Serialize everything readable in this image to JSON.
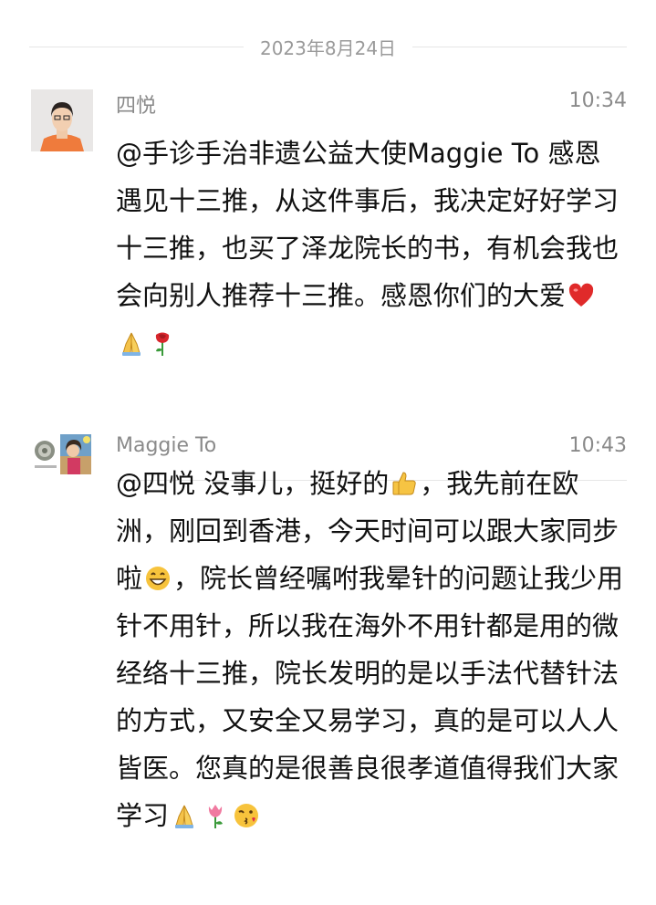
{
  "chat": {
    "date": "2023年8月24日",
    "messages": [
      {
        "sender": "四悦",
        "time": "10:34",
        "text": "@手诊手治非遗公益大使Maggie To 感恩遇见十三推，从这件事后，我决定好好学习十三推，也买了泽龙院长的书，有机会我也会向别人推荐十三推。感恩你们的大爱",
        "emojis": [
          "red-heart",
          "folded-hands",
          "rose"
        ]
      },
      {
        "sender": "Maggie To",
        "time": "10:43",
        "segments": [
          "@四悦 没事儿，挺好的",
          "，我先前在欧洲，刚回到香港，今天时间可以跟大家同步啦",
          "，院长曾经嘱咐我晕针的问题让我少用针不用针，所以我在海外不用针都是用的微经络十三推，院长发明的是以手法代替针法的方式，又安全又易学习，真的是可以人人皆医。您真的是很善良很孝道值得我们大家学习"
        ],
        "emojis": [
          "thumbs-up",
          "grinning-face",
          "folded-hands",
          "tulip",
          "kissing-face"
        ]
      }
    ]
  },
  "colors": {
    "background": "#ffffff",
    "meta_text": "#8a8a8a",
    "divider": "#e6e6e6"
  }
}
